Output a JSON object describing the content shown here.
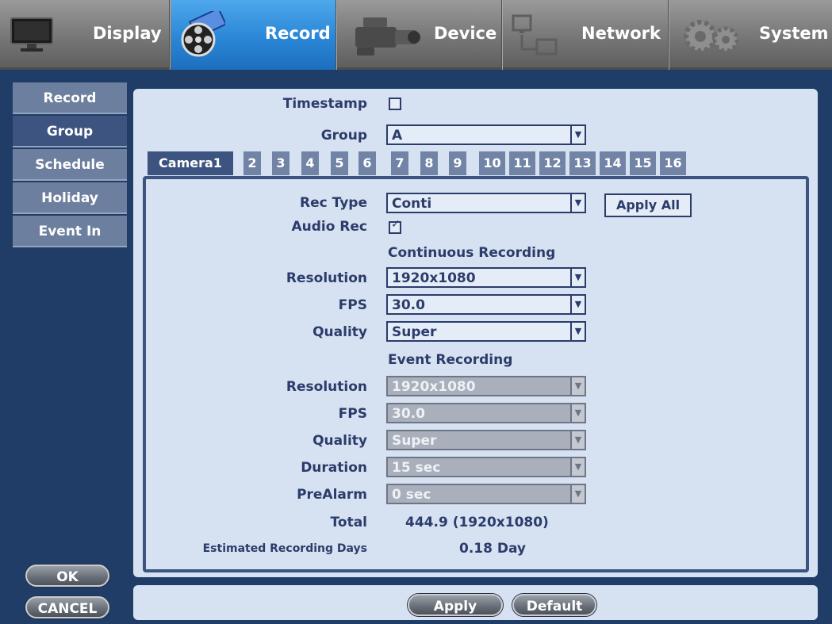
{
  "top_nav": [
    {
      "label": "Display",
      "icon": "monitor-icon"
    },
    {
      "label": "Record",
      "icon": "film-reel-icon",
      "active": true
    },
    {
      "label": "Device",
      "icon": "camcorder-icon"
    },
    {
      "label": "Network",
      "icon": "network-icon"
    },
    {
      "label": "System",
      "icon": "gears-icon"
    }
  ],
  "sidebar": {
    "items": [
      {
        "label": "Record"
      },
      {
        "label": "Group",
        "active": true
      },
      {
        "label": "Schedule"
      },
      {
        "label": "Holiday"
      },
      {
        "label": "Event In"
      }
    ],
    "ok_label": "OK",
    "cancel_label": "CANCEL"
  },
  "form": {
    "timestamp_label": "Timestamp",
    "timestamp_checked": false,
    "group_label": "Group",
    "group_value": "A"
  },
  "camera_tabs": [
    "Camera1",
    "2",
    "3",
    "4",
    "5",
    "6",
    "7",
    "8",
    "9",
    "10",
    "11",
    "12",
    "13",
    "14",
    "15",
    "16"
  ],
  "camera": {
    "rec_type_label": "Rec Type",
    "rec_type_value": "Conti",
    "apply_all_label": "Apply All",
    "audio_rec_label": "Audio Rec",
    "audio_rec_checked": true,
    "continuous_heading": "Continuous Recording",
    "continuous": {
      "resolution_label": "Resolution",
      "resolution_value": "1920x1080",
      "fps_label": "FPS",
      "fps_value": "30.0",
      "quality_label": "Quality",
      "quality_value": "Super"
    },
    "event_heading": "Event Recording",
    "event": {
      "resolution_label": "Resolution",
      "resolution_value": "1920x1080",
      "fps_label": "FPS",
      "fps_value": "30.0",
      "quality_label": "Quality",
      "quality_value": "Super",
      "duration_label": "Duration",
      "duration_value": "15 sec",
      "prealarm_label": "PreAlarm",
      "prealarm_value": "0 sec"
    },
    "total_label": "Total",
    "total_value": "444.9 (1920x1080)",
    "estimated_label": "Estimated Recording Days",
    "estimated_value": "0.18 Day"
  },
  "footer": {
    "apply_label": "Apply",
    "default_label": "Default"
  },
  "colors": {
    "active_nav": "#2a86d6",
    "background": "#1f3d66",
    "panel": "#d6e1f2",
    "text": "#2c3c6a"
  }
}
